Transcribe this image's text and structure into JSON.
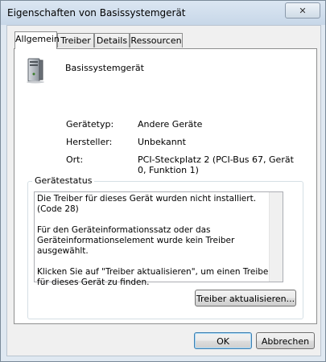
{
  "window": {
    "title": "Eigenschaften von Basissystemgerät",
    "close_symbol": "✕"
  },
  "tabs": [
    {
      "label": "Allgemein"
    },
    {
      "label": "Treiber"
    },
    {
      "label": "Details"
    },
    {
      "label": "Ressourcen"
    }
  ],
  "device": {
    "name": "Basissystemgerät",
    "fields": [
      {
        "label": "Gerätetyp:",
        "value": "Andere Geräte"
      },
      {
        "label": "Hersteller:",
        "value": "Unbekannt"
      },
      {
        "label": "Ort:",
        "value": "PCI-Steckplatz 2 (PCI-Bus 67, Gerät 0, Funktion 1)"
      }
    ]
  },
  "status": {
    "group_title": "Gerätestatus",
    "line1": "Die Treiber für dieses Gerät wurden nicht installiert. (Code 28)",
    "line2": "Für den Geräteinformationssatz oder das Geräteinformationselement wurde kein Treiber ausgewählt.",
    "line3": "Klicken Sie auf \"Treiber aktualisieren\", um einen Treiber für dieses Gerät zu finden."
  },
  "buttons": {
    "update_driver": "Treiber aktualisieren...",
    "ok": "OK",
    "cancel": "Abbrechen"
  }
}
